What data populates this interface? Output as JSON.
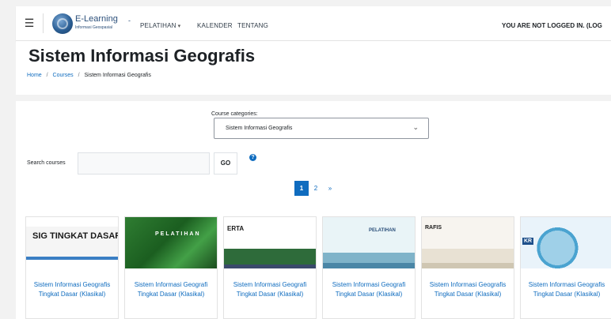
{
  "navbar": {
    "brand_title": "E-Learning",
    "brand_subtitle": "Informasi Geospasial",
    "brand_separator": "-",
    "links": [
      {
        "label": "PELATIHAN",
        "has_caret": true
      },
      {
        "label": "KALENDER",
        "has_caret": false
      },
      {
        "label": "TENTANG",
        "has_caret": false
      }
    ],
    "login_status": "YOU ARE NOT LOGGED IN. (LOG"
  },
  "header": {
    "title": "Sistem Informasi Geografis",
    "breadcrumb": [
      "Home",
      "Courses",
      "Sistem Informasi Geografis"
    ]
  },
  "filters": {
    "category_label": "Course categories:",
    "category_selected": "Sistem Informasi Geografis",
    "search_label": "Search courses",
    "search_value": "",
    "go_label": "GO",
    "help_icon": "?"
  },
  "pagination": {
    "pages": [
      "1",
      "2",
      "»"
    ],
    "current": "1"
  },
  "courses": [
    {
      "thumb_text": "SIG TINGKAT DASAR",
      "title": "Sistem Informasi Geografis Tingkat Dasar (Klasikal)"
    },
    {
      "thumb_text": "PELATIHAN",
      "title": "Sistem Informasi Geografi Tingkat Dasar (Klasikal)"
    },
    {
      "thumb_text": "ERTA",
      "title": "Sistem Informasi Geografi Tingkat Dasar (Klasikal)"
    },
    {
      "thumb_text": "PELATIHAN",
      "title": "Sistem Informasi Geografi Tingkat Dasar (Klasikal)"
    },
    {
      "thumb_text": "RAFIS",
      "title": "Sistem Informasi Geografis Tingkat Dasar (Klasikal)"
    },
    {
      "thumb_text": "KR",
      "title": "Sistem Informasi Geografis Tingkat Dasar (Klasikal)"
    }
  ],
  "colors": {
    "link": "#0f6cbf",
    "brand": "#2b4f7a",
    "page_bg": "#f2f2f2"
  }
}
